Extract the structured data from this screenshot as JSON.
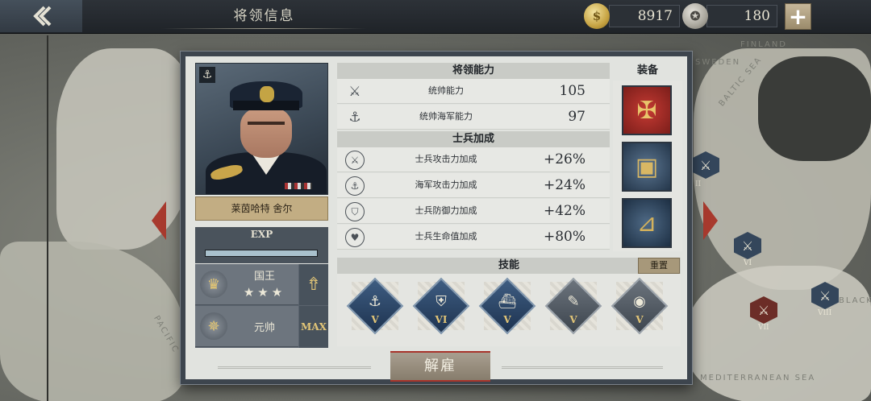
{
  "header": {
    "title": "将领信息",
    "gold": "8917",
    "silver": "180"
  },
  "map": {
    "labels": [
      "SWEDEN",
      "BALTIC SEA",
      "FINLAND",
      "PACIFIC",
      "MEDITERRANEAN SEA",
      "BLACK"
    ],
    "units": [
      {
        "type": "blue",
        "icon": "crossed-swords-icon",
        "num": "II"
      },
      {
        "type": "blue",
        "icon": "crossed-swords-icon",
        "num": "VI"
      },
      {
        "type": "red",
        "icon": "crossed-swords-icon",
        "num": "VII"
      },
      {
        "type": "blue",
        "icon": "crossed-swords-icon",
        "num": "VIII"
      }
    ]
  },
  "general": {
    "name": "莱茵哈特 舍尔",
    "exp_label": "EXP",
    "exp_fraction": 1.0,
    "rank_title": "国王",
    "stars": "★★★",
    "rank_name": "元帅",
    "max_label": "MAX"
  },
  "abilities": {
    "header": "将领能力",
    "rows": [
      {
        "icon": "crossed-swords-icon",
        "label": "统帅能力",
        "value": "105"
      },
      {
        "icon": "anchor-icon",
        "label": "统帅海军能力",
        "value": "97"
      }
    ]
  },
  "bonus": {
    "header": "士兵加成",
    "rows": [
      {
        "icon": "attack-bonus-icon",
        "label": "士兵攻击力加成",
        "value": "+26%"
      },
      {
        "icon": "naval-attack-icon",
        "label": "海军攻击力加成",
        "value": "+24%"
      },
      {
        "icon": "defense-icon",
        "label": "士兵防御力加成",
        "value": "+42%"
      },
      {
        "icon": "health-icon",
        "label": "士兵生命值加成",
        "value": "+80%"
      }
    ]
  },
  "equipment": {
    "header": "装备",
    "items": [
      "medal-icon",
      "supply-crate-icon",
      "sextant-icon"
    ]
  },
  "skills": {
    "header": "技能",
    "reset_label": "重置",
    "items": [
      {
        "icon": "anchor-wreath-icon",
        "level": "V",
        "style": "blue"
      },
      {
        "icon": "warship-shield-icon",
        "level": "VI",
        "style": "blue"
      },
      {
        "icon": "battleship-icon",
        "level": "V",
        "style": "blue"
      },
      {
        "icon": "bomb-wrench-icon",
        "level": "V",
        "style": "grey"
      },
      {
        "icon": "eye-icon",
        "level": "V",
        "style": "grey"
      }
    ]
  },
  "dismiss_label": "解雇",
  "colors": {
    "accent_red": "#a8342b",
    "gold": "#e2c577",
    "panel_border": "#3d454e"
  }
}
